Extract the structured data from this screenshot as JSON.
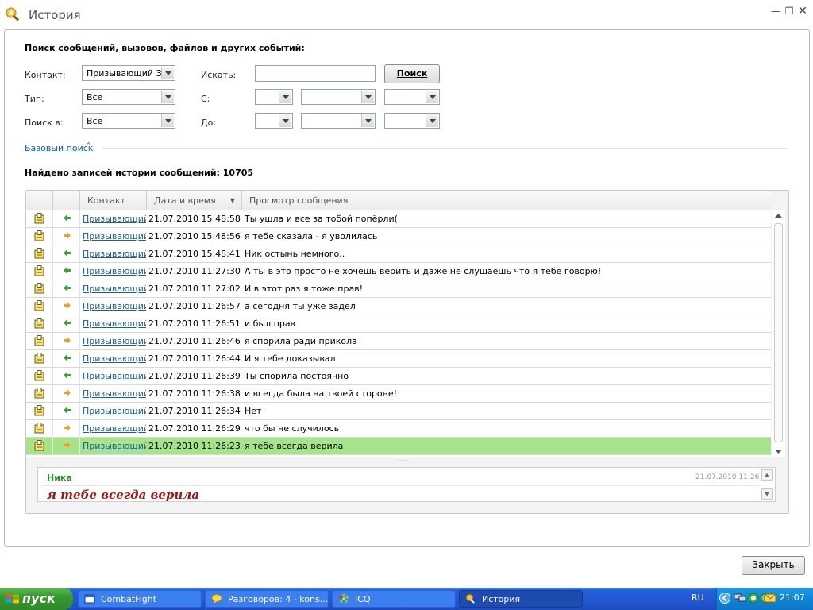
{
  "window": {
    "title": "История",
    "controls": [
      "minimize",
      "restore",
      "close"
    ]
  },
  "search": {
    "heading": "Поиск сообщений, вызовов, файлов и других событий:",
    "contact_label": "Контакт:",
    "contact_value": "Призывающий Зло",
    "type_label": "Тип:",
    "type_value": "Все",
    "search_in_label": "Поиск в:",
    "search_in_value": "Все",
    "find_label": "Искать:",
    "find_value": "",
    "from_label": "С:",
    "to_label": "До:",
    "search_button": "Поиск",
    "basic_search_link": "Базовый поиск"
  },
  "results": {
    "found_text": "Найдено записей истории сообщений: 10705",
    "columns": {
      "contact": "Контакт",
      "datetime": "Дата и время",
      "preview": "Просмотр сообщения"
    },
    "rows": [
      {
        "contact": "Призывающий Зло",
        "datetime": "21.07.2010 15:48:58",
        "message": "Ты ушла и все за тобой попёрли(",
        "direction": "in"
      },
      {
        "contact": "Призывающий Зло",
        "datetime": "21.07.2010 15:48:56",
        "message": "я тебе сказала - я уволилась",
        "direction": "out"
      },
      {
        "contact": "Призывающий Зло",
        "datetime": "21.07.2010 15:48:41",
        "message": "Ник остынь немного..",
        "direction": "in"
      },
      {
        "contact": "Призывающий Зло",
        "datetime": "21.07.2010 11:27:30",
        "message": "А ты в это просто не хочешь верить и даже не слушаешь что я тебе говорю!",
        "direction": "in"
      },
      {
        "contact": "Призывающий Зло",
        "datetime": "21.07.2010 11:27:02",
        "message": "И в этот раз я тоже прав!",
        "direction": "in"
      },
      {
        "contact": "Призывающий Зло",
        "datetime": "21.07.2010 11:26:57",
        "message": "а сегодня ты уже задел",
        "direction": "out"
      },
      {
        "contact": "Призывающий Зло",
        "datetime": "21.07.2010 11:26:51",
        "message": "и был прав",
        "direction": "in"
      },
      {
        "contact": "Призывающий Зло",
        "datetime": "21.07.2010 11:26:46",
        "message": "я спорила ради прикола",
        "direction": "out"
      },
      {
        "contact": "Призывающий Зло",
        "datetime": "21.07.2010 11:26:44",
        "message": "И я тебе доказывал",
        "direction": "in"
      },
      {
        "contact": "Призывающий Зло",
        "datetime": "21.07.2010 11:26:39",
        "message": "Ты спорила постоянно",
        "direction": "in"
      },
      {
        "contact": "Призывающий Зло",
        "datetime": "21.07.2010 11:26:38",
        "message": "и всегда была на твоей стороне!",
        "direction": "out"
      },
      {
        "contact": "Призывающий Зло",
        "datetime": "21.07.2010 11:26:34",
        "message": "Нет",
        "direction": "in"
      },
      {
        "contact": "Призывающий Зло",
        "datetime": "21.07.2010 11:26:29",
        "message": "что бы не случилось",
        "direction": "out"
      },
      {
        "contact": "Призывающий Зло",
        "datetime": "21.07.2010 11:26:23",
        "message": "я тебе всегда верила",
        "direction": "out",
        "selected": true
      }
    ]
  },
  "preview": {
    "sender": "Ника",
    "date": "21.07.2010 11:26",
    "text": "я тебе всегда верила"
  },
  "close_button": "Закрыть",
  "taskbar": {
    "start_label": "пуск",
    "tasks": [
      {
        "label": "CombatFight",
        "icon": "window-icon"
      },
      {
        "label": "Разговоров: 4 - kons...",
        "icon": "chat-icon"
      },
      {
        "label": "ICQ",
        "icon": "icq-flower-icon"
      },
      {
        "label": "История",
        "icon": "history-icon",
        "active": true
      }
    ],
    "language": "RU",
    "clock": "21:07"
  },
  "colors": {
    "selected_row": "#a6e38a",
    "link": "#1a5ea0",
    "incoming_arrow": "#3aa530",
    "outgoing_arrow": "#f0a020",
    "preview_sender": "#2e8b2e",
    "preview_text": "#a01515",
    "taskbar": "#2257d2"
  }
}
